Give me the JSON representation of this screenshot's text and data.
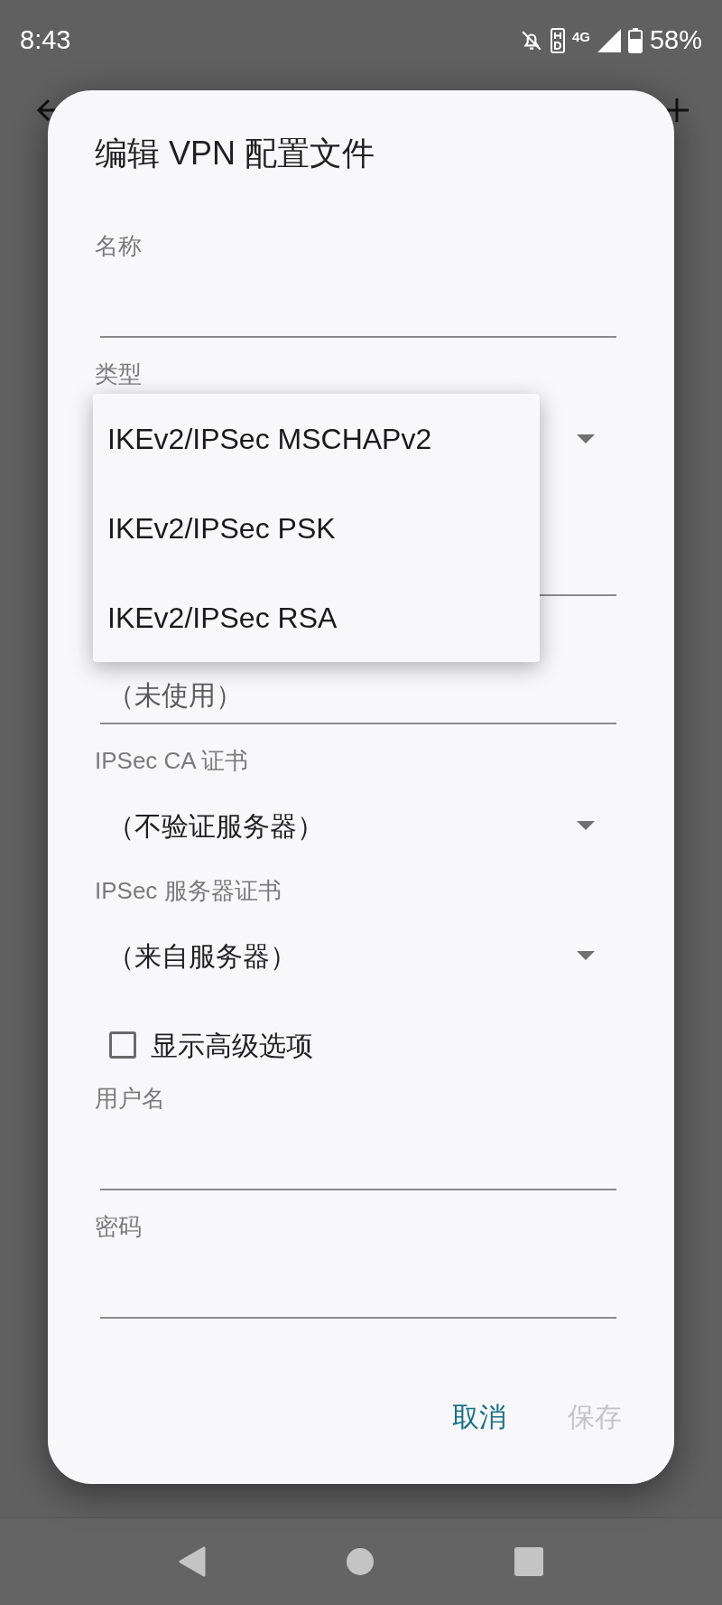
{
  "status_bar": {
    "time": "8:43",
    "network_type": "4G",
    "battery": "58%"
  },
  "dialog": {
    "title": "编辑 VPN 配置文件",
    "fields": [
      {
        "kind": "text",
        "label": "名称"
      },
      {
        "kind": "spinner",
        "label": "类型"
      },
      {
        "kind": "text"
      },
      {
        "kind": "text",
        "placeholder": "（未使用）"
      },
      {
        "kind": "spinner",
        "label": "IPSec CA 证书",
        "value": "（不验证服务器）"
      },
      {
        "kind": "spinner",
        "label": "IPSec 服务器证书",
        "value": "（来自服务器）"
      },
      {
        "kind": "checkbox",
        "label": "显示高级选项",
        "checked": false
      },
      {
        "kind": "text",
        "label": "用户名"
      },
      {
        "kind": "text",
        "label": "密码"
      }
    ],
    "menu": {
      "options": [
        "IKEv2/IPSec MSCHAPv2",
        "IKEv2/IPSec PSK",
        "IKEv2/IPSec RSA"
      ]
    },
    "buttons": [
      {
        "label": "取消",
        "disabled": false
      },
      {
        "label": "保存",
        "disabled": true
      }
    ]
  }
}
